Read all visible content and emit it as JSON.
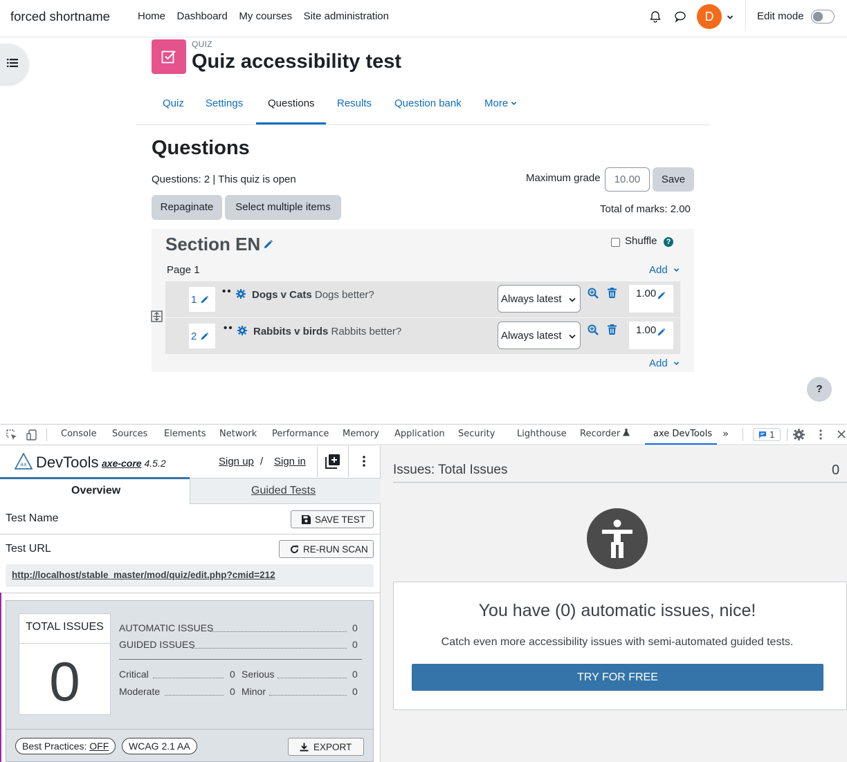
{
  "navbar": {
    "brand": "forced shortname",
    "links": [
      "Home",
      "Dashboard",
      "My courses",
      "Site administration"
    ],
    "avatar_initial": "D",
    "edit_mode_label": "Edit mode"
  },
  "header": {
    "activity_type": "QUIZ",
    "title": "Quiz accessibility test"
  },
  "secondary_nav": {
    "tabs": [
      "Quiz",
      "Settings",
      "Questions",
      "Results",
      "Question bank",
      "More"
    ],
    "active": "Questions"
  },
  "questions_page": {
    "heading": "Questions",
    "status": "Questions: 2 | This quiz is open",
    "max_grade_label": "Maximum grade",
    "max_grade_value": "10.00",
    "save_label": "Save",
    "repaginate_label": "Repaginate",
    "select_multiple_label": "Select multiple items",
    "total_marks": "Total of marks: 2.00",
    "section": {
      "title": "Section EN",
      "shuffle_label": "Shuffle",
      "page_label": "Page 1",
      "add_label": "Add",
      "questions": [
        {
          "number": "1",
          "name": "Dogs v Cats",
          "text": "Dogs better?",
          "version": "Always latest",
          "mark": "1.00"
        },
        {
          "number": "2",
          "name": "Rabbits v birds",
          "text": "Rabbits better?",
          "version": "Always latest",
          "mark": "1.00"
        }
      ]
    },
    "help_label": "?"
  },
  "devtools": {
    "tabs": [
      "Console",
      "Sources",
      "Elements",
      "Network",
      "Performance",
      "Memory",
      "Application",
      "Security",
      "Lighthouse",
      "Recorder",
      "axe DevTools"
    ],
    "active_tab": "axe DevTools",
    "issues_badge": "1",
    "colors": {
      "active": "#1a73e8"
    }
  },
  "axe": {
    "logo_text": "DevTools",
    "core_label": "axe-core",
    "core_version": "4.5.2",
    "sign_up": "Sign up",
    "slash": "/",
    "sign_in": "Sign in",
    "tab_overview": "Overview",
    "tab_guided": "Guided Tests",
    "test_name_label": "Test Name",
    "save_test_label": "SAVE TEST",
    "test_url_label": "Test URL",
    "rerun_label": "RE-RUN SCAN",
    "url": "http://localhost/stable_master/mod/quiz/edit.php?cmid=212",
    "total_issues_label": "TOTAL ISSUES",
    "total_issues": "0",
    "automatic_label": "AUTOMATIC ISSUES",
    "automatic": "0",
    "guided_label": "GUIDED ISSUES",
    "guided": "0",
    "critical_label": "Critical",
    "critical": "0",
    "serious_label": "Serious",
    "serious": "0",
    "moderate_label": "Moderate",
    "moderate": "0",
    "minor_label": "Minor",
    "minor": "0",
    "best_practices_label": "Best Practices:",
    "best_practices_value": "OFF",
    "wcag_label": "WCAG 2.1 AA",
    "export_label": "EXPORT",
    "issues_title": "Issues: Total Issues",
    "issues_count": "0",
    "nice_title": "You have (0) automatic issues, nice!",
    "nice_sub": "Catch even more accessibility issues with semi-automated guided tests.",
    "try_label": "TRY FOR FREE",
    "colors": {
      "primary": "#3474a8"
    }
  }
}
